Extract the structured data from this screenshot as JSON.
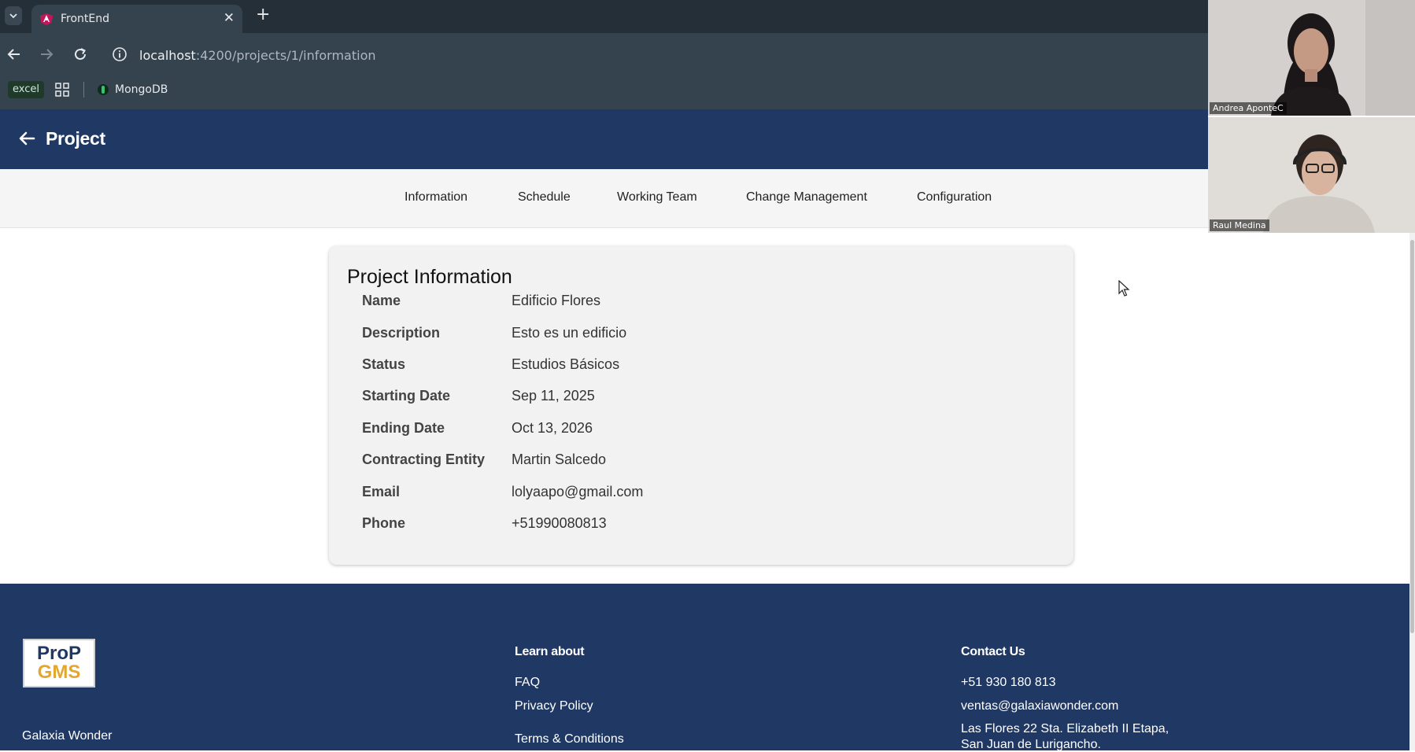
{
  "browser": {
    "tab_title": "FrontEnd",
    "url_host": "localhost",
    "url_path": ":4200/projects/1/information",
    "bookmarks": {
      "excel": "excel",
      "mongodb": "MongoDB"
    }
  },
  "header": {
    "title": "Project"
  },
  "tabs": [
    {
      "label": "Information"
    },
    {
      "label": "Schedule"
    },
    {
      "label": "Working Team"
    },
    {
      "label": "Change Management"
    },
    {
      "label": "Configuration"
    }
  ],
  "card": {
    "title": "Project Information",
    "rows": [
      {
        "label": "Name",
        "value": "Edificio Flores"
      },
      {
        "label": "Description",
        "value": "Esto es un edificio"
      },
      {
        "label": "Status",
        "value": "Estudios Básicos"
      },
      {
        "label": "Starting Date",
        "value": "Sep 11, 2025"
      },
      {
        "label": "Ending Date",
        "value": "Oct 13, 2026"
      },
      {
        "label": "Contracting Entity",
        "value": "Martin Salcedo"
      },
      {
        "label": "Email",
        "value": "lolyaapo@gmail.com"
      },
      {
        "label": "Phone",
        "value": "+51990080813"
      }
    ]
  },
  "footer": {
    "logo_line1": "ProP",
    "logo_line2": "GMS",
    "company": "Galaxia Wonder",
    "learn_title": "Learn about",
    "learn_links": [
      "FAQ",
      "Privacy Policy",
      "Terms & Conditions"
    ],
    "contact_title": "Contact Us",
    "phone": "+51 930 180 813",
    "email": "ventas@galaxiawonder.com",
    "address_line1": "Las Flores 22 Sta. Elizabeth II Etapa,",
    "address_line2": "San Juan de Lurigancho."
  },
  "video_call": {
    "participant_1": "Andrea AponteC",
    "participant_2": "Raul Medina"
  },
  "colors": {
    "brand_navy": "#203864",
    "logo_gold": "#e3a72f"
  }
}
